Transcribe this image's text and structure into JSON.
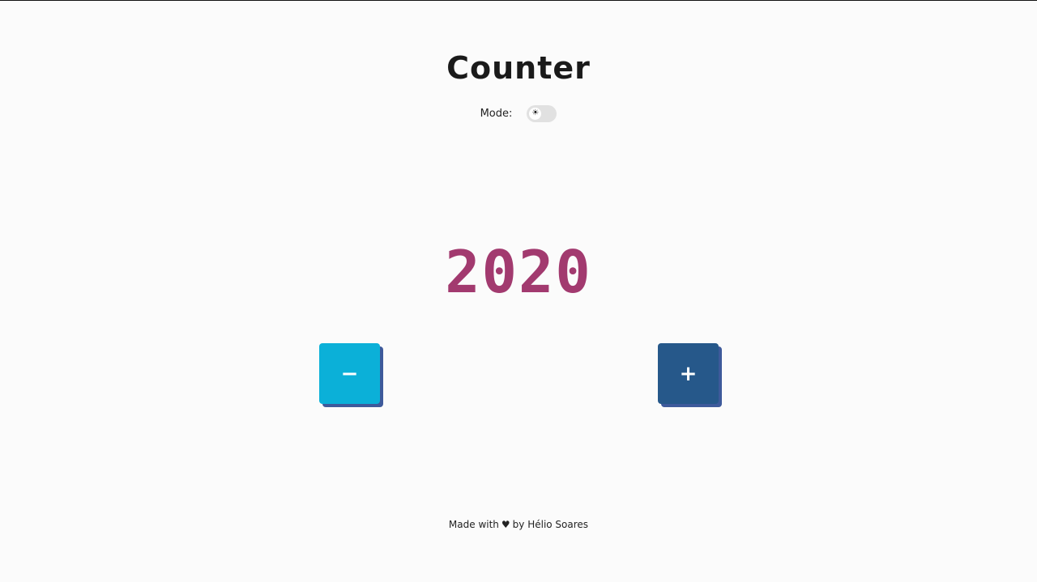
{
  "header": {
    "title": "Counter"
  },
  "mode": {
    "label": "Mode:",
    "toggle_icon": "sun-icon",
    "toggle_glyph": "☀",
    "dark_mode_on": false
  },
  "counter": {
    "value": "2020",
    "color": "#a23a6f"
  },
  "buttons": {
    "decrement_label": "−",
    "increment_label": "+",
    "decrement_color": "#0bb0d8",
    "increment_color": "#26588a"
  },
  "footer": {
    "made_with": "Made with",
    "heart_icon": "heart-icon",
    "heart_glyph": "♥",
    "by": "by Hélio Soares"
  }
}
